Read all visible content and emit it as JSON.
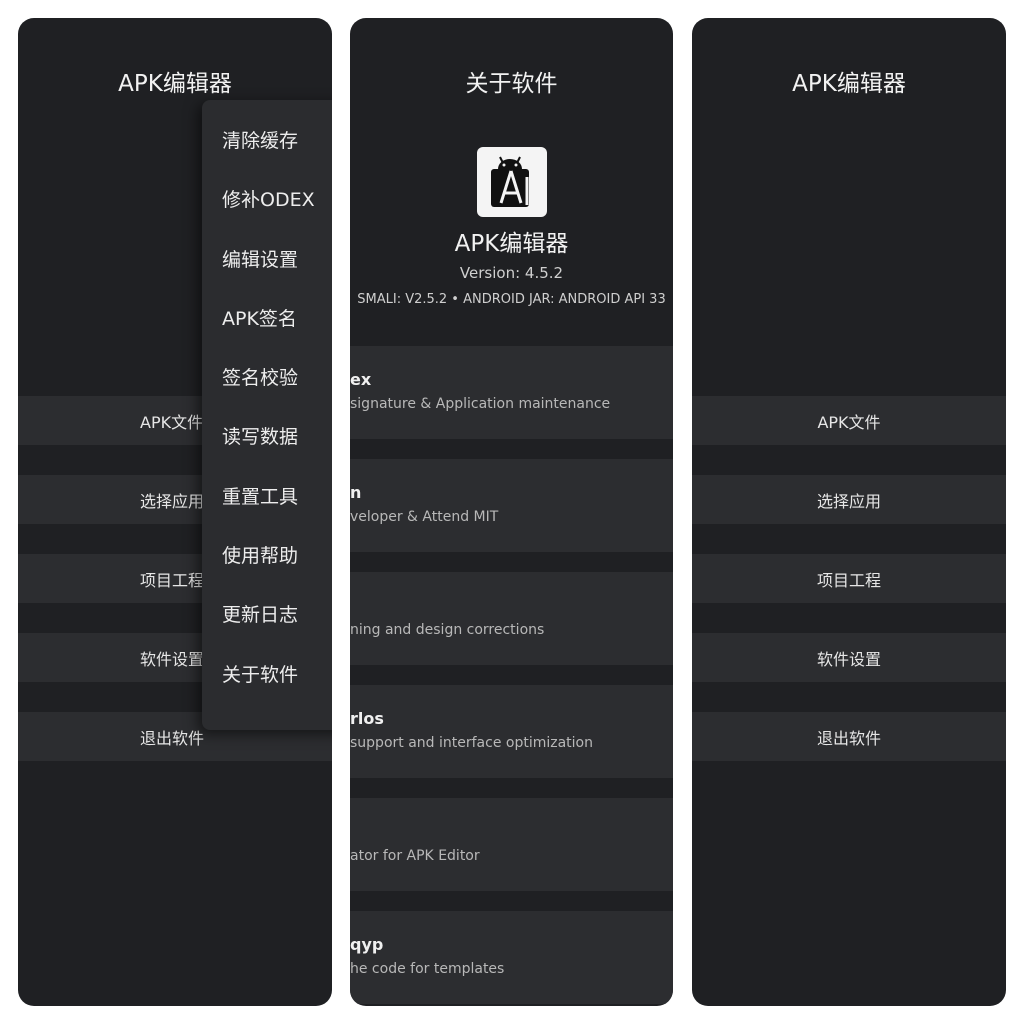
{
  "panel_left": {
    "title": "APK编辑器",
    "menu": [
      "APK文件",
      "选择应用",
      "项目工程",
      "软件设置",
      "退出软件"
    ],
    "popup_menu": [
      "清除缓存",
      "修补ODEX",
      "编辑设置",
      "APK签名",
      "签名校验",
      "读写数据",
      "重置工具",
      "使用帮助",
      "更新日志",
      "关于软件"
    ]
  },
  "panel_about": {
    "title": "关于软件",
    "app_icon": "android-studio-icon",
    "app_name": "APK编辑器",
    "version": "Version: 4.5.2",
    "libraries": "SMALI: V2.5.2 • ANDROID JAR: ANDROID API 33",
    "credits": [
      {
        "name": "ex",
        "desc": "signature & Application maintenance"
      },
      {
        "name": "n",
        "desc": "veloper & Attend MIT"
      },
      {
        "name": "",
        "desc": "ning and design corrections"
      },
      {
        "name": "rlos",
        "desc": "support and interface optimization"
      },
      {
        "name": "",
        "desc": "ator for APK Editor"
      },
      {
        "name": "qyp",
        "desc": "he code for templates"
      }
    ]
  },
  "panel_right": {
    "title": "APK编辑器",
    "menu": [
      "APK文件",
      "选择应用",
      "项目工程",
      "软件设置",
      "退出软件"
    ]
  }
}
